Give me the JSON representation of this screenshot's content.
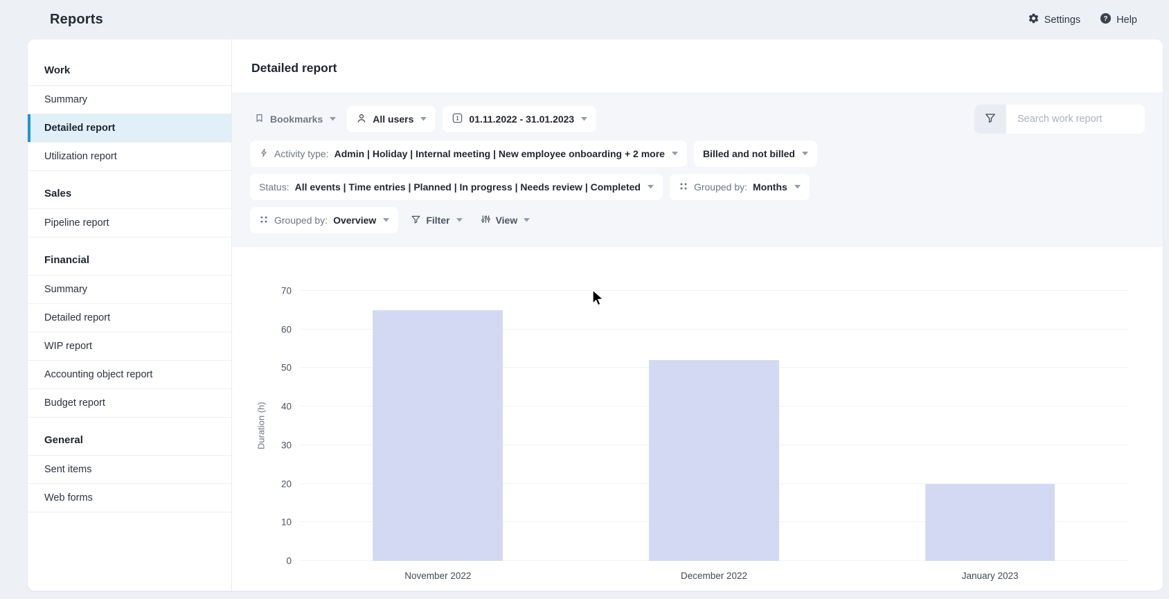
{
  "header": {
    "title": "Reports",
    "actions": [
      {
        "label": "Settings",
        "icon": "gear-icon"
      },
      {
        "label": "Help",
        "icon": "help-icon"
      }
    ]
  },
  "sidebar": {
    "sections": [
      {
        "heading": "Work",
        "items": [
          {
            "label": "Summary"
          },
          {
            "label": "Detailed report",
            "selected": true
          },
          {
            "label": "Utilization report"
          }
        ]
      },
      {
        "heading": "Sales",
        "items": [
          {
            "label": "Pipeline report"
          }
        ]
      },
      {
        "heading": "Financial",
        "items": [
          {
            "label": "Summary"
          },
          {
            "label": "Detailed report"
          },
          {
            "label": "WIP report"
          },
          {
            "label": "Accounting object report"
          },
          {
            "label": "Budget report"
          }
        ]
      },
      {
        "heading": "General",
        "items": [
          {
            "label": "Sent items"
          },
          {
            "label": "Web forms"
          }
        ]
      }
    ]
  },
  "main": {
    "title": "Detailed report",
    "filters": {
      "bookmarks": "Bookmarks",
      "users": "All users",
      "date_range": "01.11.2022 - 31.01.2023",
      "activity_label": "Activity type:",
      "activity_value": "Admin | Holiday | Internal meeting | New employee onboarding + 2 more",
      "billed": "Billed and not billed",
      "status_label": "Status:",
      "status_value": "All events | Time entries | Planned | In progress | Needs review | Completed",
      "grouped_label": "Grouped by:",
      "grouped_months": "Months",
      "grouped_overview": "Overview",
      "filter": "Filter",
      "view": "View"
    },
    "search": {
      "placeholder": "Search work report"
    }
  },
  "chart_data": {
    "type": "bar",
    "categories": [
      "November 2022",
      "December 2022",
      "January 2023"
    ],
    "values": [
      65,
      52,
      20
    ],
    "title": "",
    "xlabel": "",
    "ylabel": "Duration (h)",
    "ylim": [
      0,
      70
    ],
    "yticks": [
      0,
      10,
      20,
      30,
      40,
      50,
      60,
      70
    ],
    "grid": true,
    "legend": false,
    "bar_color": "#d3d9f3"
  },
  "colors": {
    "accent": "#1a96d5",
    "selected_bg": "#e1f0f8",
    "page_bg": "#edf0f5",
    "panel_bg": "#f4f6f9",
    "bar": "#d3d9f3"
  }
}
